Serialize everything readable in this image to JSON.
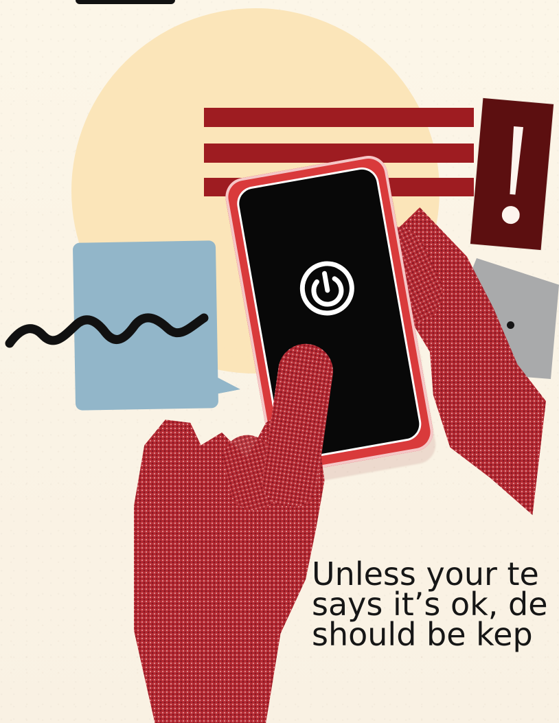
{
  "illustration": {
    "colors": {
      "background": "#fbf5e6",
      "sun_circle": "#fbe4b6",
      "stripe": "#9e1c21",
      "alert_card": "#5c0f10",
      "chat_bubble": "#92b6c9",
      "pentagon": "#a9aaab",
      "phone_screen": "#080808",
      "hands": "#b62c34",
      "text": "#161616"
    },
    "icons": [
      "exclamation-icon",
      "power-icon",
      "ellipsis-icon",
      "squiggle-line-icon"
    ]
  },
  "message": {
    "lines": [
      "Unless your te",
      "says it’s ok, de",
      "should be kep"
    ]
  }
}
